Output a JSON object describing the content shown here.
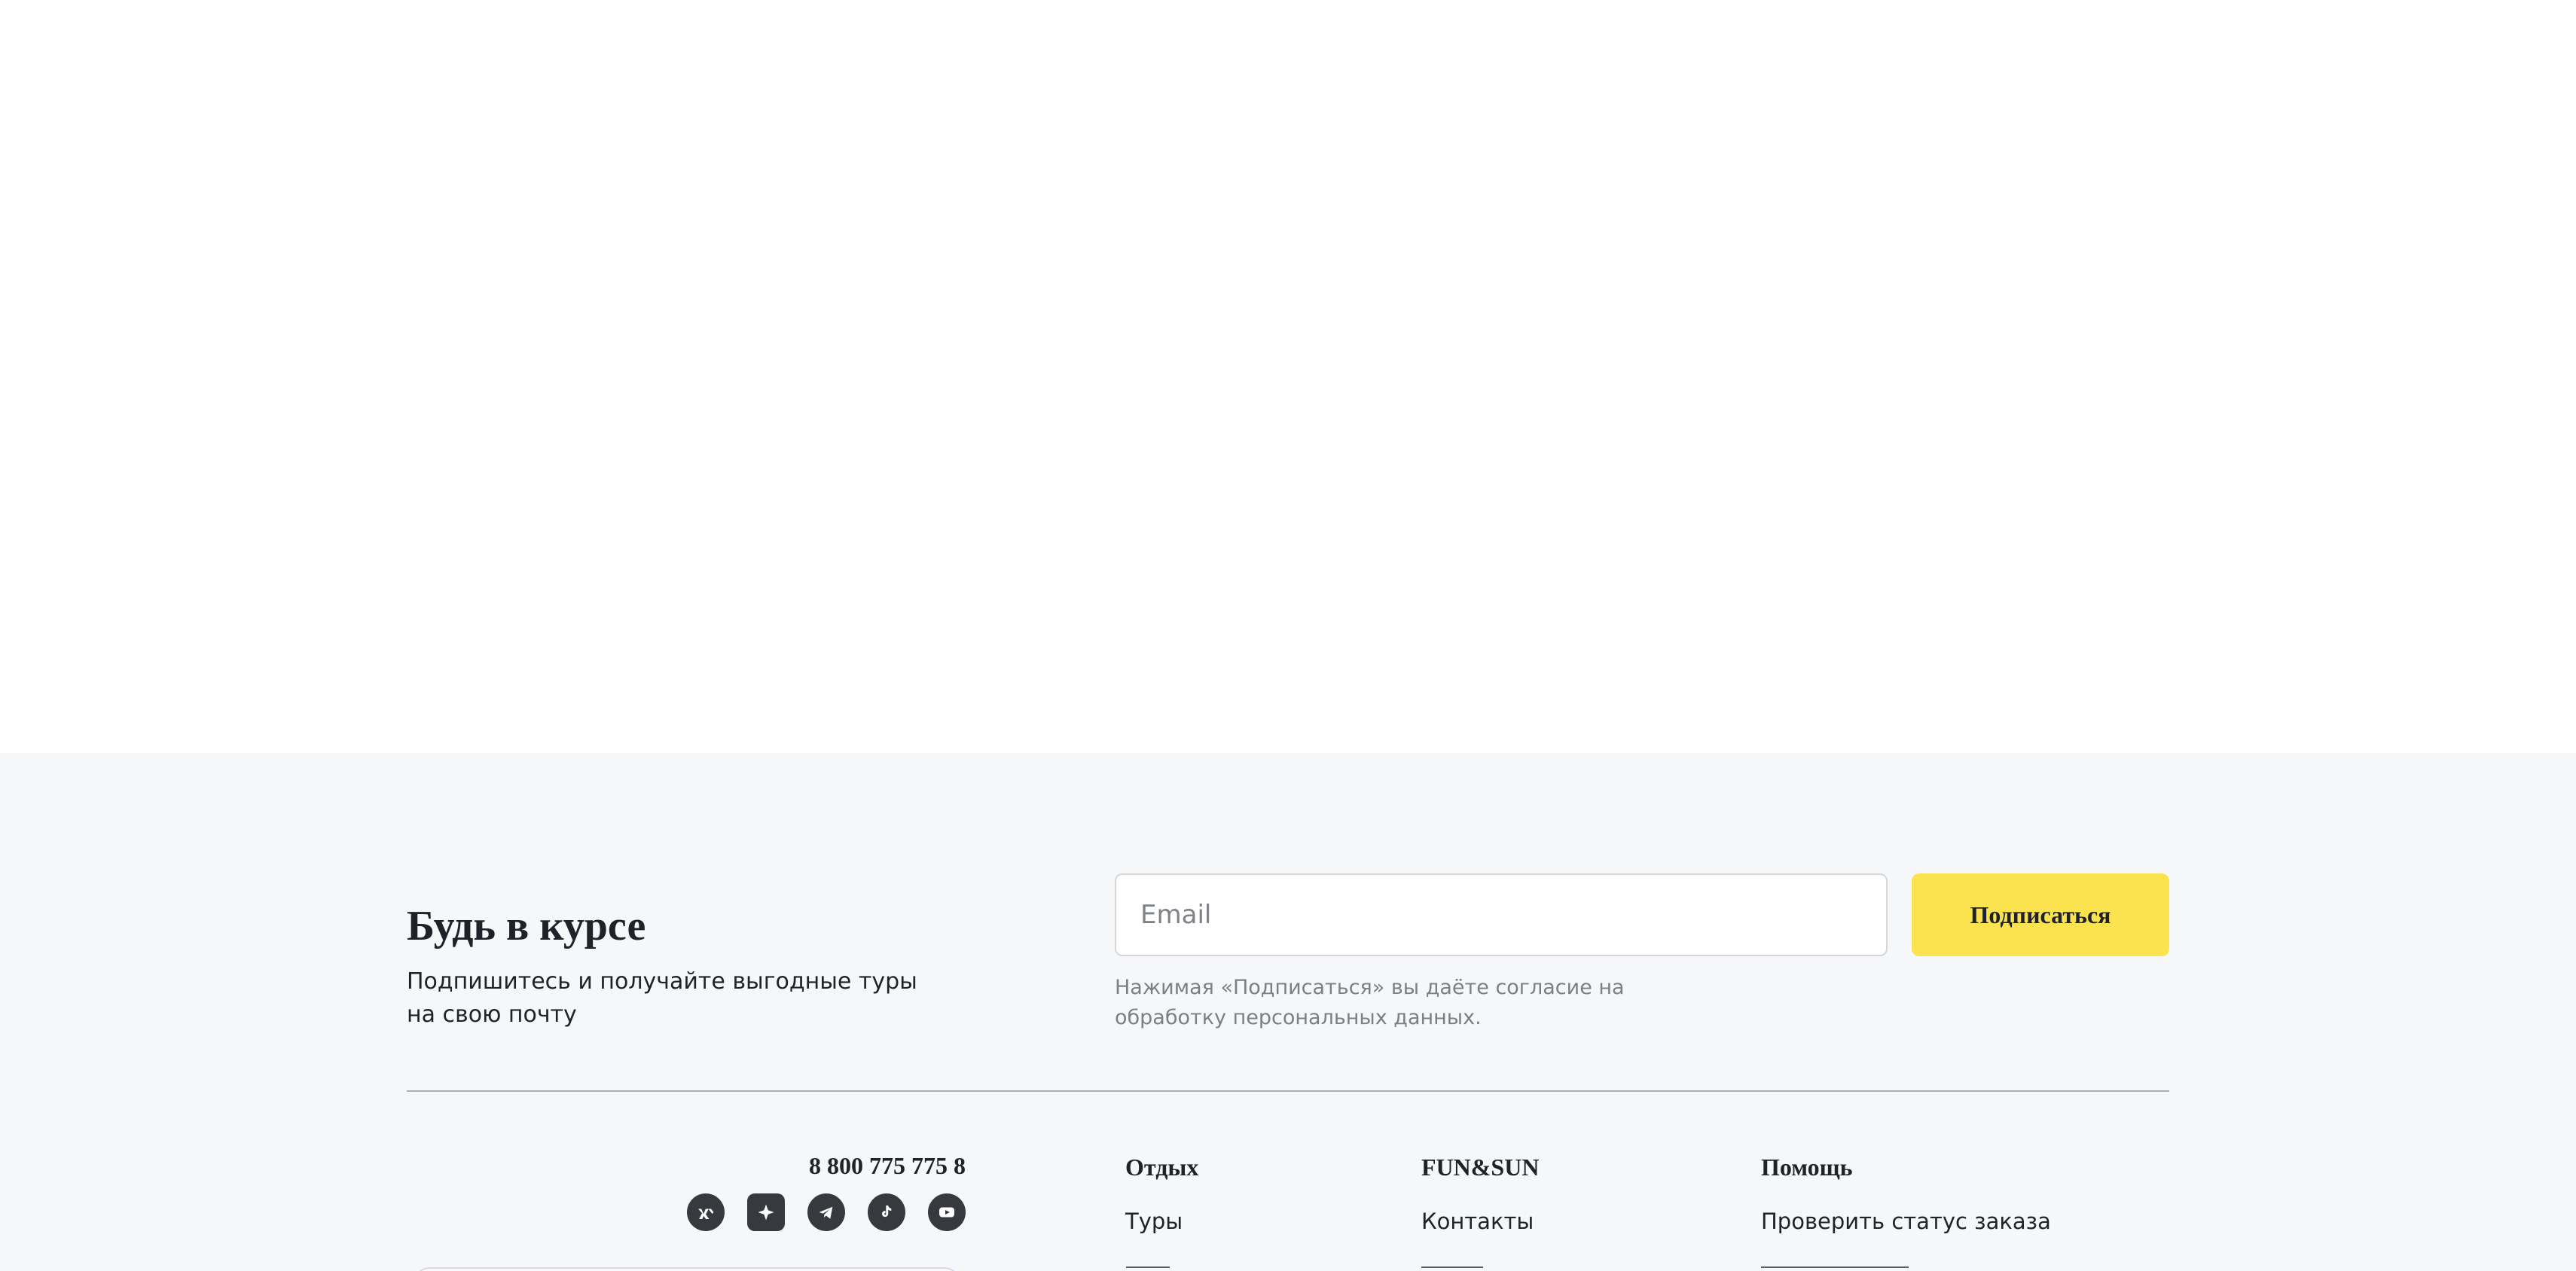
{
  "subscribe": {
    "title": "Будь в курсе",
    "subtitle": "Подпишитесь и получайте выгодные туры на свою почту",
    "email_placeholder": "Email",
    "button_label": "Подписаться",
    "consent": "Нажимая «Подписаться» вы даёте согласие на обработку персональных данных."
  },
  "contacts": {
    "phone": "8 800 775 775 8",
    "socials": [
      {
        "name": "vk-icon"
      },
      {
        "name": "sparkle-icon"
      },
      {
        "name": "telegram-icon"
      },
      {
        "name": "tiktok-icon"
      },
      {
        "name": "youtube-icon"
      }
    ]
  },
  "nav": {
    "rest": {
      "heading": "Отдых",
      "links": [
        "Туры"
      ]
    },
    "brand": {
      "heading": "FUN&SUN",
      "links": [
        "Контакты"
      ]
    },
    "help": {
      "heading": "Помощь",
      "links": [
        "Проверить статус заказа"
      ]
    }
  },
  "colors": {
    "footer_background": "#f6f7f8",
    "accent_button": "#fbe34f",
    "text_primary": "#1f2329",
    "text_secondary": "#7b7f86",
    "social_icon_background": "#36393d"
  }
}
